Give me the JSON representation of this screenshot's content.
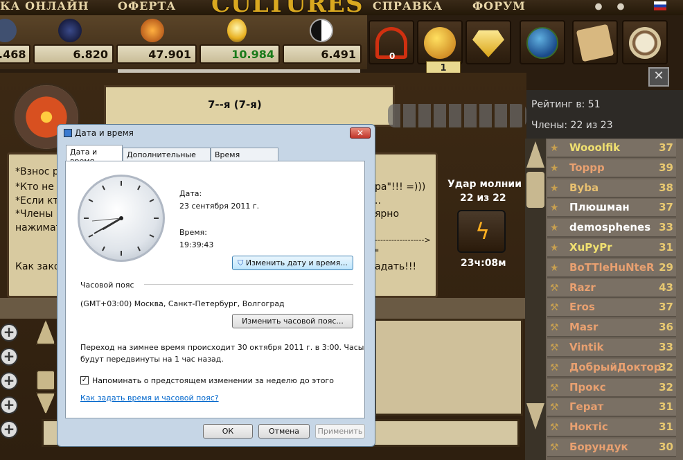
{
  "topmenu": {
    "items": [
      "КА ОНЛАЙН",
      "ОФЕРТА",
      "СПРАВКА",
      "ФОРУМ"
    ],
    "logo": "CULTURES"
  },
  "resources": {
    "values": [
      ".468",
      "6.820",
      "47.901",
      "10.984",
      "6.491"
    ],
    "highlight_color": "#1a7a1a"
  },
  "icon_buttons": {
    "badge": "0",
    "mail_count": "1",
    "icons": [
      "triskelion-icon",
      "coin-icon",
      "diamond-icon",
      "globe-icon",
      "map-scroll-icon",
      "compass-icon"
    ]
  },
  "guild": {
    "title": "7--я (7-я)"
  },
  "notes": {
    "lines_left": [
      "*Взнос р",
      "*Кто не С",
      "*Если кт",
      "*Члены к",
      "нажимат",
      "Как зако"
    ],
    "lines_right": [
      "ра\"!!! =)))",
      "..",
      "ярно",
      "------------------>",
      "\"",
      "адать!!!"
    ]
  },
  "strike": {
    "label": "Удар молнии",
    "count": "22 из 22",
    "timer": "23ч:08м"
  },
  "ranking": {
    "rating_label": "Рейтинг в: 51",
    "members_label": "Члены: 22 из 23",
    "rows": [
      {
        "name": "Wooolfik",
        "score": "37",
        "color": "#f0e070"
      },
      {
        "name": "Toppp",
        "score": "39",
        "color": "#e8a070"
      },
      {
        "name": "Byba",
        "score": "38",
        "color": "#e8c070"
      },
      {
        "name": "Плюшман",
        "score": "37",
        "color": "#ffffff"
      },
      {
        "name": "demosphenes",
        "score": "33",
        "color": "#ffffff"
      },
      {
        "name": "XuPyPr",
        "score": "31",
        "color": "#f0e070"
      },
      {
        "name": "BoTTleHuNteR",
        "score": "29",
        "color": "#e8a070"
      },
      {
        "name": "Razr",
        "score": "43",
        "color": "#e8a070"
      },
      {
        "name": "Eros",
        "score": "37",
        "color": "#e8a070"
      },
      {
        "name": "Masr",
        "score": "36",
        "color": "#e8a070"
      },
      {
        "name": "Vintik",
        "score": "33",
        "color": "#e8a070"
      },
      {
        "name": "ДобрыйДоктор",
        "score": "32",
        "color": "#e8a070"
      },
      {
        "name": "Прокс",
        "score": "32",
        "color": "#e8a070"
      },
      {
        "name": "Герат",
        "score": "31",
        "color": "#e8a070"
      },
      {
        "name": "Ноктіс",
        "score": "31",
        "color": "#e8a070"
      },
      {
        "name": "Борундук",
        "score": "30",
        "color": "#e8a070"
      }
    ]
  },
  "dialog": {
    "title": "Дата и время",
    "tabs": [
      "Дата и время",
      "Дополнительные часы",
      "Время Интернета"
    ],
    "date_label": "Дата:",
    "date_value": "23 сентября 2011 г.",
    "time_label": "Время:",
    "time_value": "19:39:43",
    "change_datetime_button": "Изменить дату и время...",
    "timezone_header": "Часовой пояс",
    "timezone_value": "(GMT+03:00) Москва, Санкт-Петербург, Волгоград",
    "change_timezone_button": "Изменить часовой пояс...",
    "dst_text_1": "Переход на зимнее время происходит 30 октября 2011 г. в 3:00. Часы",
    "dst_text_2": "будут передвинуты на 1 час назад.",
    "remind_checkbox_label": "Напоминать о предстоящем изменении за неделю до этого",
    "remind_checked": "✓",
    "help_link": "Как задать время и часовой пояс?",
    "ok_button": "ОК",
    "cancel_button": "Отмена",
    "apply_button": "Применить"
  }
}
